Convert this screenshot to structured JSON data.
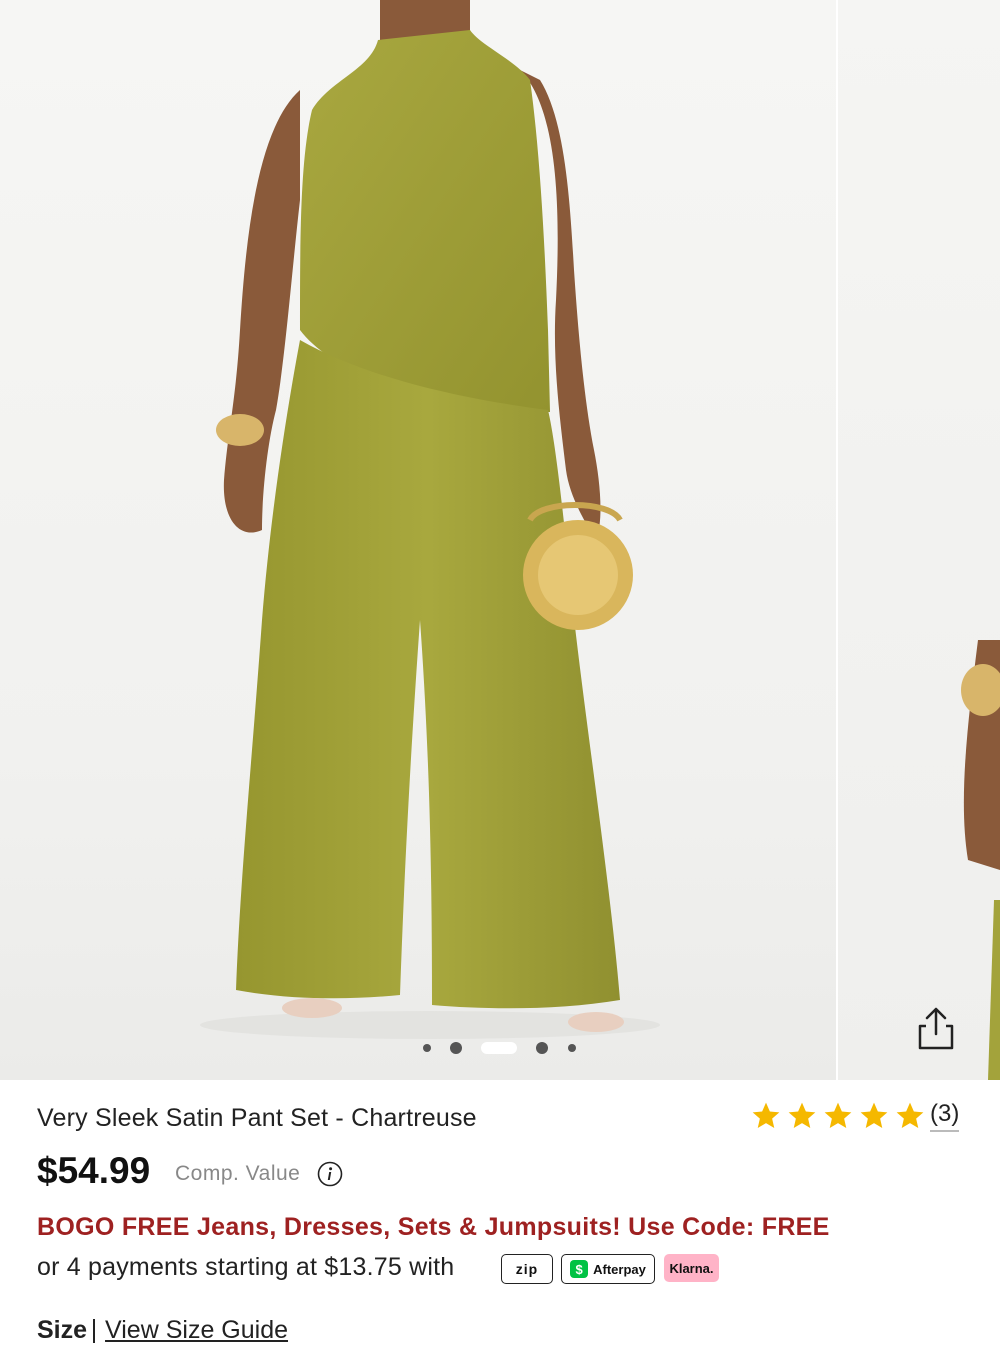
{
  "carousel": {
    "slide_count": 5,
    "active_index": 2,
    "share_icon": "share-icon"
  },
  "product": {
    "title": "Very Sleek Satin Pant Set - Chartreuse",
    "rating": 5,
    "review_count": "(3)",
    "price": "$54.99",
    "comp_value_label": "Comp. Value",
    "promo": "BOGO FREE Jeans, Dresses, Sets & Jumpsuits! Use Code: FREE",
    "payments_text": "or 4 payments starting at $13.75 with",
    "providers": {
      "zip": "zip",
      "afterpay": "Afterpay",
      "klarna": "Klarna."
    },
    "size_label": "Size",
    "size_guide": "View Size Guide"
  },
  "colors": {
    "outfit": "#a3a33b",
    "promo": "#9e2121",
    "star": "#f5b800",
    "klarna": "#ffb3c7",
    "afterpay_cash": "#00c244"
  }
}
